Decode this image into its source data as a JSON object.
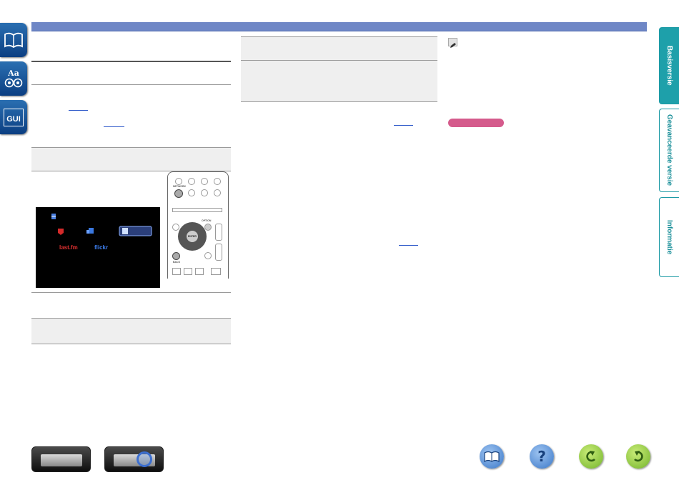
{
  "side_tabs": [
    {
      "label": "Basisversie",
      "active": true
    },
    {
      "label": "Geavanceerde versie",
      "active": false
    },
    {
      "label": "Informatie",
      "active": false
    }
  ],
  "left_icons": [
    {
      "icon": "book-icon"
    },
    {
      "icon": "glossary-icon",
      "text": "Aa"
    },
    {
      "icon": "gui-icon",
      "text": "GUI"
    }
  ],
  "screen": {
    "items": [
      {
        "label": "last.fm",
        "color": "#e03030"
      },
      {
        "label": "flickr",
        "color": "#3c7be8"
      }
    ]
  },
  "remote": {
    "buttons": [
      "NETWORK",
      "OPTION",
      "BACK",
      "ENTER"
    ]
  },
  "bottom_nav": [
    {
      "icon": "amplifier-front-icon"
    },
    {
      "icon": "amplifier-rear-icon"
    },
    {
      "icon": "book-nav-icon"
    },
    {
      "icon": "help-icon",
      "text": "?"
    },
    {
      "icon": "back-icon"
    },
    {
      "icon": "forward-icon"
    }
  ],
  "colors": {
    "header": "#6f87c6",
    "tab_active": "#1ea0aa",
    "memo": "#d55b8c"
  }
}
